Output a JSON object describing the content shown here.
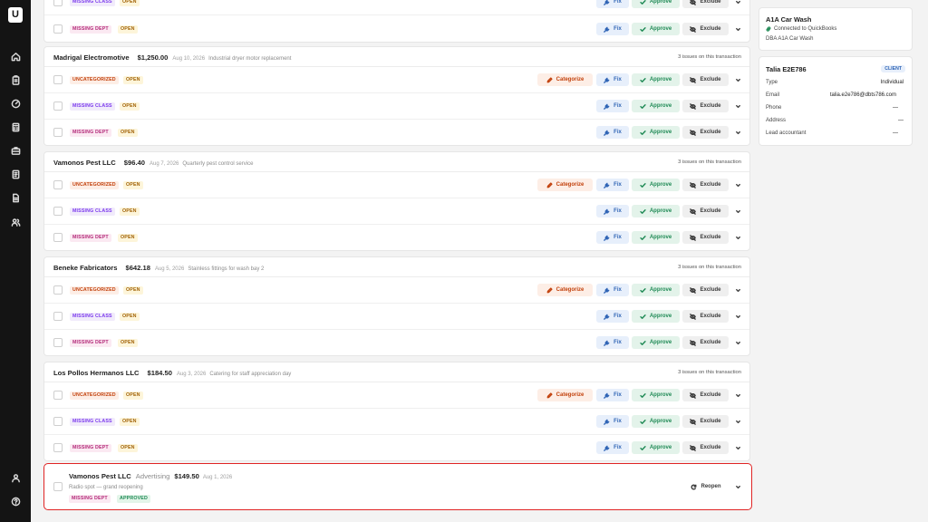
{
  "nav": {
    "logo_text": "U",
    "items": [
      "home-icon",
      "clipboard-icon",
      "gauge-icon",
      "calculator-icon",
      "briefcase-icon",
      "ledger-icon",
      "document-icon",
      "users-icon"
    ],
    "bottom": [
      "user-icon",
      "help-icon"
    ]
  },
  "labels": {
    "fix": "Fix",
    "approve": "Approve",
    "exclude": "Exclude",
    "categorize": "Categorize",
    "reopen": "Reopen",
    "open": "OPEN",
    "approved": "APPROVED",
    "uncategorized": "UNCATEGORIZED",
    "missing_class": "MISSING CLASS",
    "missing_dept": "MISSING DEPT"
  },
  "top_partial": {
    "rows": [
      "missing_class",
      "missing_dept"
    ]
  },
  "groups": [
    {
      "vendor": "Madrigal Electromotive",
      "amount": "$1,250.00",
      "date": "Aug 10, 2026",
      "description": "Industrial dryer motor replacement",
      "issues": "3 issues on this transaction"
    },
    {
      "vendor": "Vamonos Pest LLC",
      "amount": "$96.40",
      "date": "Aug 7, 2026",
      "description": "Quarterly pest control service",
      "issues": "3 issues on this transaction"
    },
    {
      "vendor": "Beneke Fabricators",
      "amount": "$642.18",
      "date": "Aug 5, 2026",
      "description": "Stainless fittings for wash bay 2",
      "issues": "3 issues on this transaction"
    },
    {
      "vendor": "Los Pollos Hermanos LLC",
      "amount": "$184.50",
      "date": "Aug 3, 2026",
      "description": "Catering for staff appreciation day",
      "issues": "3 issues on this transaction"
    }
  ],
  "resolved": {
    "vendor": "Vamonos Pest LLC",
    "category": "Advertising",
    "amount": "$149.50",
    "date": "Aug 1, 2026",
    "description": "Radio spot — grand reopening"
  },
  "company_card": {
    "title": "A1A Car Wash",
    "connection": "Connected to QuickBooks",
    "dba": "DBA A1A Car Wash"
  },
  "contact_card": {
    "name": "Talia E2E786",
    "badge": "CLIENT",
    "fields": [
      {
        "label": "Type",
        "value": "Individual"
      },
      {
        "label": "Email",
        "value": "talia.e2e786@dbts786.com"
      },
      {
        "label": "Phone",
        "value": "—"
      },
      {
        "label": "Address",
        "value": "—"
      },
      {
        "label": "Lead accountant",
        "value": "—"
      }
    ]
  },
  "colors": {
    "sidebar": "#141414",
    "highlight_border": "#e02424",
    "approve": "#1f8a55",
    "fix": "#2f64b5",
    "categorize": "#c2410c"
  }
}
